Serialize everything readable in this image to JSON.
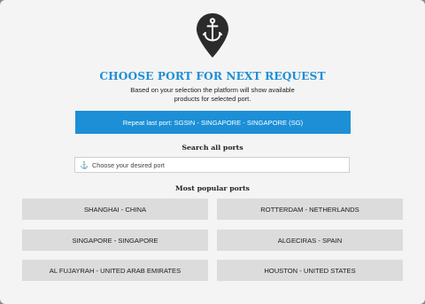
{
  "modal": {
    "title": "CHOOSE PORT FOR NEXT REQUEST",
    "subtitle_line1": "Based on your selection the platform will show available",
    "subtitle_line2": "products for selected port.",
    "repeat_button": "Repeat last port: SGSIN - SINGAPORE - SINGAPORE (SG)",
    "search_title": "Search all ports",
    "search_placeholder": "Choose your desired port",
    "popular_title": "Most popular ports",
    "ports": [
      "SHANGHAI - CHINA",
      "ROTTERDAM - NETHERLANDS",
      "SINGAPORE - SINGAPORE",
      "ALGECIRAS - SPAIN",
      "AL FUJAYRAH - UNITED ARAB EMIRATES",
      "HOUSTON - UNITED STATES"
    ]
  },
  "colors": {
    "accent": "#1c8fd6",
    "title": "#1e8fd6",
    "pin": "#2b2b2b",
    "port_bg": "#dcdcdc",
    "modal_bg": "#f4f4f4"
  },
  "icons": {
    "header": "anchor-pin-icon",
    "search": "anchor-icon"
  }
}
